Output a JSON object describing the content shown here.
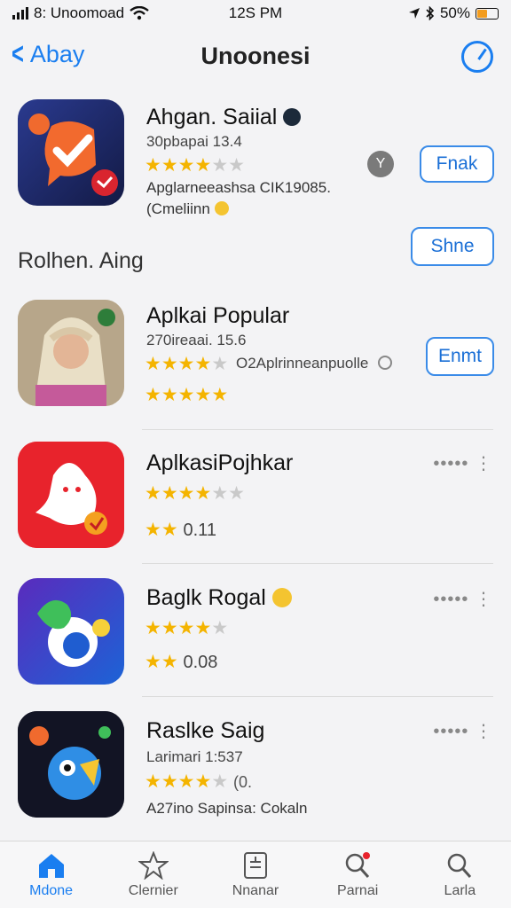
{
  "status": {
    "carrier": "8: Unoomoad",
    "time": "12S PM",
    "battery_text": "50%",
    "battery_level": 0.5,
    "battery_color": "#f39c1e"
  },
  "nav": {
    "back_label": "Abay",
    "title": "Unoonesi"
  },
  "colors": {
    "accent": "#1a7ef0",
    "star": "#f4b400"
  },
  "featured": {
    "title": "Ahgan. Saiial",
    "subtitle": "30pbapai 13.4",
    "stars_on": 4,
    "stars_total": 6,
    "desc_line1": "Apglarneeashsa CIK19085.",
    "desc_line2": "(Cmeliinn",
    "button": "Fnak"
  },
  "section": {
    "title": "Rolhen. Aing",
    "button": "Shne"
  },
  "apps": [
    {
      "title": "Aplkai Popular",
      "subtitle": "270ireaai. 15.6",
      "stars_on": 4,
      "stars_total": 5,
      "stars_note": "O2Aplrinneanpuolle",
      "stars2": 5,
      "button": "Enmt"
    },
    {
      "title": "AplkasiPojhkar",
      "stars_on": 4,
      "stars_total": 6,
      "rating2": "0.11",
      "stars2": 2,
      "dots": "•••••  ⋮"
    },
    {
      "title": "Baglk Rogal",
      "stars_on": 4,
      "stars_total": 5,
      "rating2": "0.08",
      "stars2": 2,
      "dots": "•••••  ⋮"
    },
    {
      "title": "Raslke Saig",
      "subtitle": "Larimari 1:537",
      "stars_on": 4,
      "stars_total": 5,
      "stars_note": "(0.",
      "desc": "A27ino Sapinsa: Cokaln",
      "dots": "•••••  ⋮"
    }
  ],
  "tabs": [
    {
      "label": "Mdone",
      "icon": "home-icon",
      "active": true
    },
    {
      "label": "Clernier",
      "icon": "star-icon",
      "active": false
    },
    {
      "label": "Nnanar",
      "icon": "list-icon",
      "active": false
    },
    {
      "label": "Parnai",
      "icon": "search-icon",
      "active": false
    },
    {
      "label": "Larla",
      "icon": "search-icon",
      "active": false
    }
  ]
}
